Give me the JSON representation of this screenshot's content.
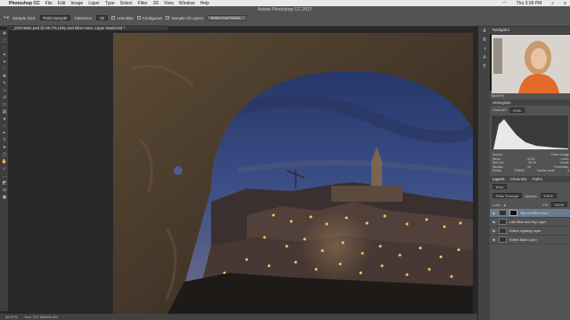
{
  "mac_menu": {
    "app": "Photoshop CC",
    "items": [
      "File",
      "Edit",
      "Image",
      "Layer",
      "Type",
      "Select",
      "Filter",
      "3D",
      "View",
      "Window",
      "Help"
    ],
    "clock": "Thu 3:38 PM"
  },
  "window_title": "Adobe Photoshop CC 2017",
  "options_bar": {
    "sample_size_label": "Sample Size:",
    "sample_size_value": "Point Sample",
    "tolerance_label": "Tolerance:",
    "tolerance_value": "32",
    "anti_alias": "Anti-alias",
    "contiguous": "Contiguous",
    "sample_all_layers": "Sample All Layers",
    "select_mask": "Select and Mask..."
  },
  "document_tab": "_DSF4581.psd @ 66.7% (Sky and Blue Hour, Layer Mask/16) *",
  "status": {
    "zoom": "66.67%",
    "doc": "Doc: 207.9M/839.3M"
  },
  "navigator": {
    "title": "Navigator",
    "zoom": "66.67%"
  },
  "histogram": {
    "title": "Histogram",
    "channel_label": "Channel:",
    "channel_value": "RGB",
    "source_label": "Source:",
    "source_value": "Entire Image",
    "stats": [
      {
        "k": "Mean:",
        "v": "44.62",
        "k2": "Level:",
        "v2": ""
      },
      {
        "k": "Std Dev:",
        "v": "26.18",
        "k2": "Count:",
        "v2": ""
      },
      {
        "k": "Median:",
        "v": "43",
        "k2": "Percentile:",
        "v2": ""
      },
      {
        "k": "Pixels:",
        "v": "378000",
        "k2": "Cache Level:",
        "v2": "4"
      }
    ]
  },
  "layers_panel": {
    "tabs": [
      "Layers",
      "Channels",
      "Paths"
    ],
    "kind": "Kind",
    "blend_mode": "Pass Through",
    "opacity_label": "Opacity:",
    "opacity_value": "100%",
    "fill_label": "Fill:",
    "fill_value": "100%",
    "lock_label": "Lock:",
    "layers": [
      {
        "name": "Sky and Blue Hour",
        "selected": true
      },
      {
        "name": "Late Blue and Sky Layer",
        "selected": false
      },
      {
        "name": "Edited Lighting Layer",
        "selected": false
      },
      {
        "name": "Edited Base Layer",
        "selected": false
      }
    ]
  },
  "colors": {
    "ui_dark": "#282828",
    "panel": "#535353",
    "selection": "#6a7a8f"
  }
}
